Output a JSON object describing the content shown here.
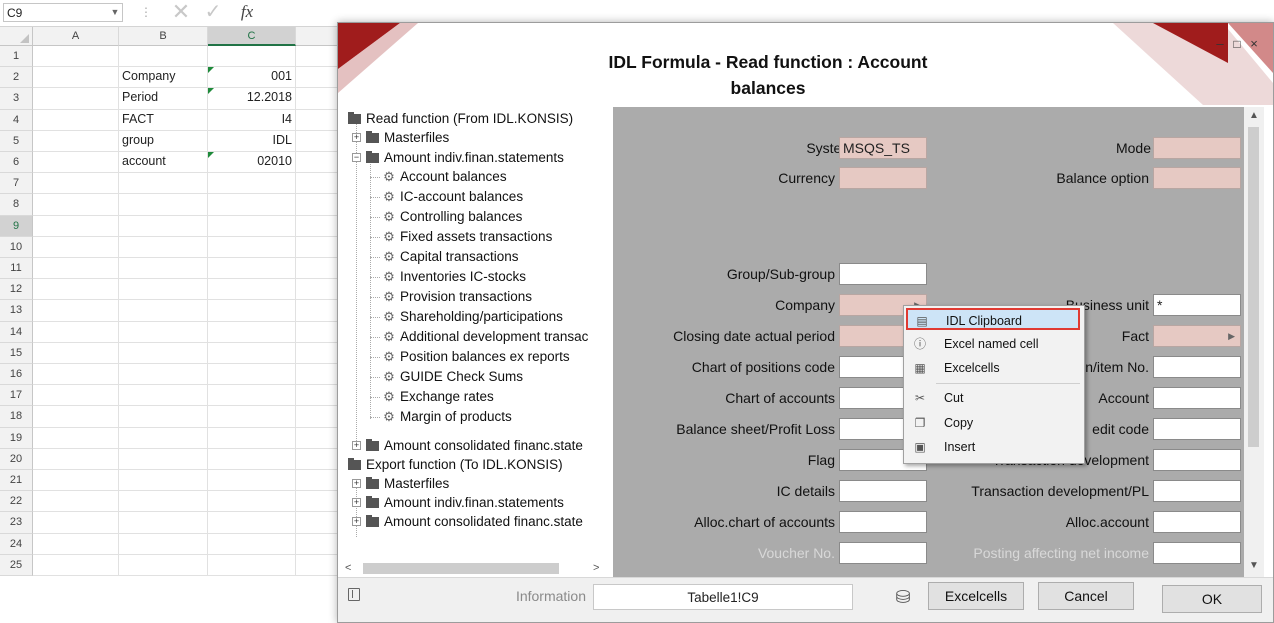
{
  "excel": {
    "namebox": "C9",
    "fx": "fx",
    "columns": [
      "A",
      "B",
      "C"
    ],
    "rows": [
      "1",
      "2",
      "3",
      "4",
      "5",
      "6",
      "7",
      "8",
      "9",
      "10",
      "11",
      "12",
      "13",
      "14",
      "15",
      "16",
      "17",
      "18",
      "19",
      "20",
      "21",
      "22",
      "23",
      "24",
      "25"
    ],
    "cells": [
      {
        "label": "Company",
        "value": "001"
      },
      {
        "label": "Period",
        "value": "12.2018"
      },
      {
        "label": "FACT",
        "value": "I4"
      },
      {
        "label": "group",
        "value": "IDL"
      },
      {
        "label": "account",
        "value": "02010"
      }
    ]
  },
  "dialog": {
    "title_line1": "IDL Formula - Read function : Account",
    "title_line2": "balances",
    "window_controls": {
      "minimize": "–",
      "maximize": "□",
      "close": "×"
    },
    "tree": {
      "read_root": "Read function (From IDL.KONSIS)",
      "masterfiles": "Masterfiles",
      "amount_indiv": "Amount indiv.finan.statements",
      "read_items": [
        "Account balances",
        "IC-account balances",
        "Controlling balances",
        "Fixed assets transactions",
        "Capital transactions",
        "Inventories IC-stocks",
        "Provision transactions",
        "Shareholding/participations",
        "Additional development transac",
        "Position balances ex reports",
        "GUIDE Check Sums",
        "Exchange rates",
        "Margin of products"
      ],
      "amount_consolidated": "Amount consolidated financ.state",
      "export_root": "Export function (To IDL.KONSIS)",
      "export_masterfiles": "Masterfiles",
      "export_amount_indiv": "Amount indiv.finan.statements",
      "export_amount_consolidated": "Amount consolidated financ.state"
    },
    "fields": {
      "system_label": "System",
      "system_value": "MSQS_TS",
      "mode_label": "Mode",
      "currency_label": "Currency",
      "balance_option_label": "Balance option",
      "group_label": "Group/Sub-group",
      "company_label": "Company",
      "business_unit_label": "Business unit",
      "business_unit_value": "*",
      "closing_date_label": "Closing date actual period",
      "fact_label": "Fact",
      "chart_positions_label": "Chart of positions code",
      "item_no_label": "n/item No.",
      "chart_accounts_label": "Chart of accounts",
      "account_label": "Account",
      "balance_sheet_label": "Balance sheet/Profit  Loss",
      "credit_code_label": "edit code",
      "flag_label": "Flag",
      "transaction_dev_label": "Transaction development",
      "ic_details_label": "IC details",
      "transaction_dev_pl_label": "Transaction development/PL",
      "alloc_chart_label": "Alloc.chart of accounts",
      "alloc_account_label": "Alloc.account",
      "voucher_label": "Voucher No.",
      "posting_label": "Posting affecting net income"
    },
    "bottom": {
      "information_label": "Information",
      "information_value": "Tabelle1!C9",
      "excelcells_button": "Excelcells",
      "cancel_button": "Cancel",
      "ok_button": "OK"
    }
  },
  "context_menu": {
    "items": [
      "IDL Clipboard",
      "Excel named cell",
      "Excelcells",
      "Cut",
      "Copy",
      "Insert"
    ]
  },
  "colors": {
    "required_field": "#e6c9c3",
    "panel_bg": "#ababab",
    "menu_highlight": "#cde4f7",
    "highlight_border": "#e03a32",
    "deco_red": "#a01c1c"
  }
}
